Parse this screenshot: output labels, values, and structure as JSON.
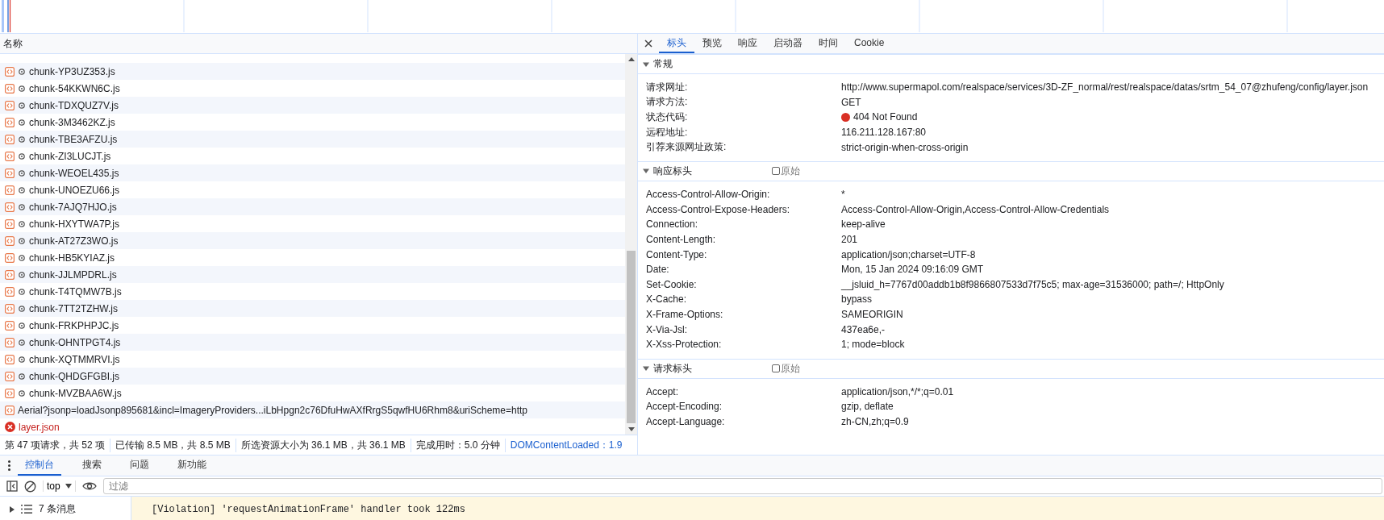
{
  "requests": {
    "column_header": "名称",
    "rows": [
      {
        "kind": "script",
        "name": "chunk-YP3UZ353.js"
      },
      {
        "kind": "script",
        "name": "chunk-54KKWN6C.js"
      },
      {
        "kind": "script",
        "name": "chunk-TDXQUZ7V.js"
      },
      {
        "kind": "script",
        "name": "chunk-3M3462KZ.js"
      },
      {
        "kind": "script",
        "name": "chunk-TBE3AFZU.js"
      },
      {
        "kind": "script",
        "name": "chunk-ZI3LUCJT.js"
      },
      {
        "kind": "script",
        "name": "chunk-WEOEL435.js"
      },
      {
        "kind": "script",
        "name": "chunk-UNOEZU66.js"
      },
      {
        "kind": "script",
        "name": "chunk-7AJQ7HJO.js"
      },
      {
        "kind": "script",
        "name": "chunk-HXYTWA7P.js"
      },
      {
        "kind": "script",
        "name": "chunk-AT27Z3WO.js"
      },
      {
        "kind": "script",
        "name": "chunk-HB5KYIAZ.js"
      },
      {
        "kind": "script",
        "name": "chunk-JJLMPDRL.js"
      },
      {
        "kind": "script",
        "name": "chunk-T4TQMW7B.js"
      },
      {
        "kind": "script",
        "name": "chunk-7TT2TZHW.js"
      },
      {
        "kind": "script",
        "name": "chunk-FRKPHPJC.js"
      },
      {
        "kind": "script",
        "name": "chunk-OHNTPGT4.js"
      },
      {
        "kind": "script",
        "name": "chunk-XQTMMRVI.js"
      },
      {
        "kind": "script",
        "name": "chunk-QHDGFGBI.js"
      },
      {
        "kind": "script",
        "name": "chunk-MVZBAA6W.js"
      },
      {
        "kind": "jsonp",
        "name": "Aerial?jsonp=loadJsonp895681&incl=ImageryProviders...iLbHpgn2c76DfuHwAXfRrgS5qwfHU6Rhm8&uriScheme=http"
      },
      {
        "kind": "error",
        "name": "layer.json"
      }
    ]
  },
  "status_bar": [
    "第 47 项请求，共 52 项",
    "已传输 8.5 MB，共 8.5 MB",
    "所选资源大小为 36.1 MB，共 36.1 MB",
    "完成用时：5.0 分钟",
    "DOMContentLoaded：1.9"
  ],
  "detail": {
    "tabs": [
      {
        "label": "标头",
        "selected": true
      },
      {
        "label": "预览",
        "selected": false
      },
      {
        "label": "响应",
        "selected": false
      },
      {
        "label": "启动器",
        "selected": false
      },
      {
        "label": "时间",
        "selected": false
      },
      {
        "label": "Cookie",
        "selected": false
      }
    ],
    "sections": [
      {
        "title": "常规",
        "expanded": true,
        "rows": [
          {
            "kind": "text",
            "name": "请求网址:",
            "value": "http://www.supermapol.com/realspace/services/3D-ZF_normal/rest/realspace/datas/srtm_54_07@zhufeng/config/layer.json"
          },
          {
            "kind": "text",
            "name": "请求方法:",
            "value": "GET"
          },
          {
            "kind": "status",
            "name": "状态代码:",
            "value": "404 Not Found"
          },
          {
            "kind": "text",
            "name": "远程地址:",
            "value": "116.211.128.167:80"
          },
          {
            "kind": "text",
            "name": "引荐来源网址政策:",
            "value": "strict-origin-when-cross-origin"
          }
        ]
      },
      {
        "title": "响应标头",
        "expanded": true,
        "raw_checkbox": {
          "label": "原始",
          "checked": false
        },
        "rows": [
          {
            "kind": "text",
            "name": "Access-Control-Allow-Origin:",
            "value": "*"
          },
          {
            "kind": "text",
            "name": "Access-Control-Expose-Headers:",
            "value": "Access-Control-Allow-Origin,Access-Control-Allow-Credentials"
          },
          {
            "kind": "text",
            "name": "Connection:",
            "value": "keep-alive"
          },
          {
            "kind": "text",
            "name": "Content-Length:",
            "value": "201"
          },
          {
            "kind": "text",
            "name": "Content-Type:",
            "value": "application/json;charset=UTF-8"
          },
          {
            "kind": "text",
            "name": "Date:",
            "value": "Mon, 15 Jan 2024 09:16:09 GMT"
          },
          {
            "kind": "text",
            "name": "Set-Cookie:",
            "value": "__jsluid_h=7767d00addb1b8f9866807533d7f75c5; max-age=31536000; path=/; HttpOnly"
          },
          {
            "kind": "text",
            "name": "X-Cache:",
            "value": "bypass"
          },
          {
            "kind": "text",
            "name": "X-Frame-Options:",
            "value": "SAMEORIGIN"
          },
          {
            "kind": "text",
            "name": "X-Via-Jsl:",
            "value": "437ea6e,-"
          },
          {
            "kind": "text",
            "name": "X-Xss-Protection:",
            "value": "1; mode=block"
          }
        ]
      },
      {
        "title": "请求标头",
        "expanded": true,
        "raw_checkbox": {
          "label": "原始",
          "checked": false
        },
        "rows": [
          {
            "kind": "text",
            "name": "Accept:",
            "value": "application/json,*/*;q=0.01"
          },
          {
            "kind": "text",
            "name": "Accept-Encoding:",
            "value": "gzip, deflate"
          },
          {
            "kind": "text",
            "name": "Accept-Language:",
            "value": "zh-CN,zh;q=0.9"
          }
        ]
      }
    ]
  },
  "drawer": {
    "tabs": [
      {
        "label": "控制台",
        "selected": true
      },
      {
        "label": "搜索",
        "selected": false
      },
      {
        "label": "问题",
        "selected": false
      },
      {
        "label": "新功能",
        "selected": false
      }
    ],
    "context": "top",
    "filter_placeholder": "过滤",
    "message_count": "7 条消息",
    "messages": [
      {
        "kind": "warning",
        "text": "[Violation] 'requestAnimationFrame' handler took 122ms"
      }
    ]
  }
}
